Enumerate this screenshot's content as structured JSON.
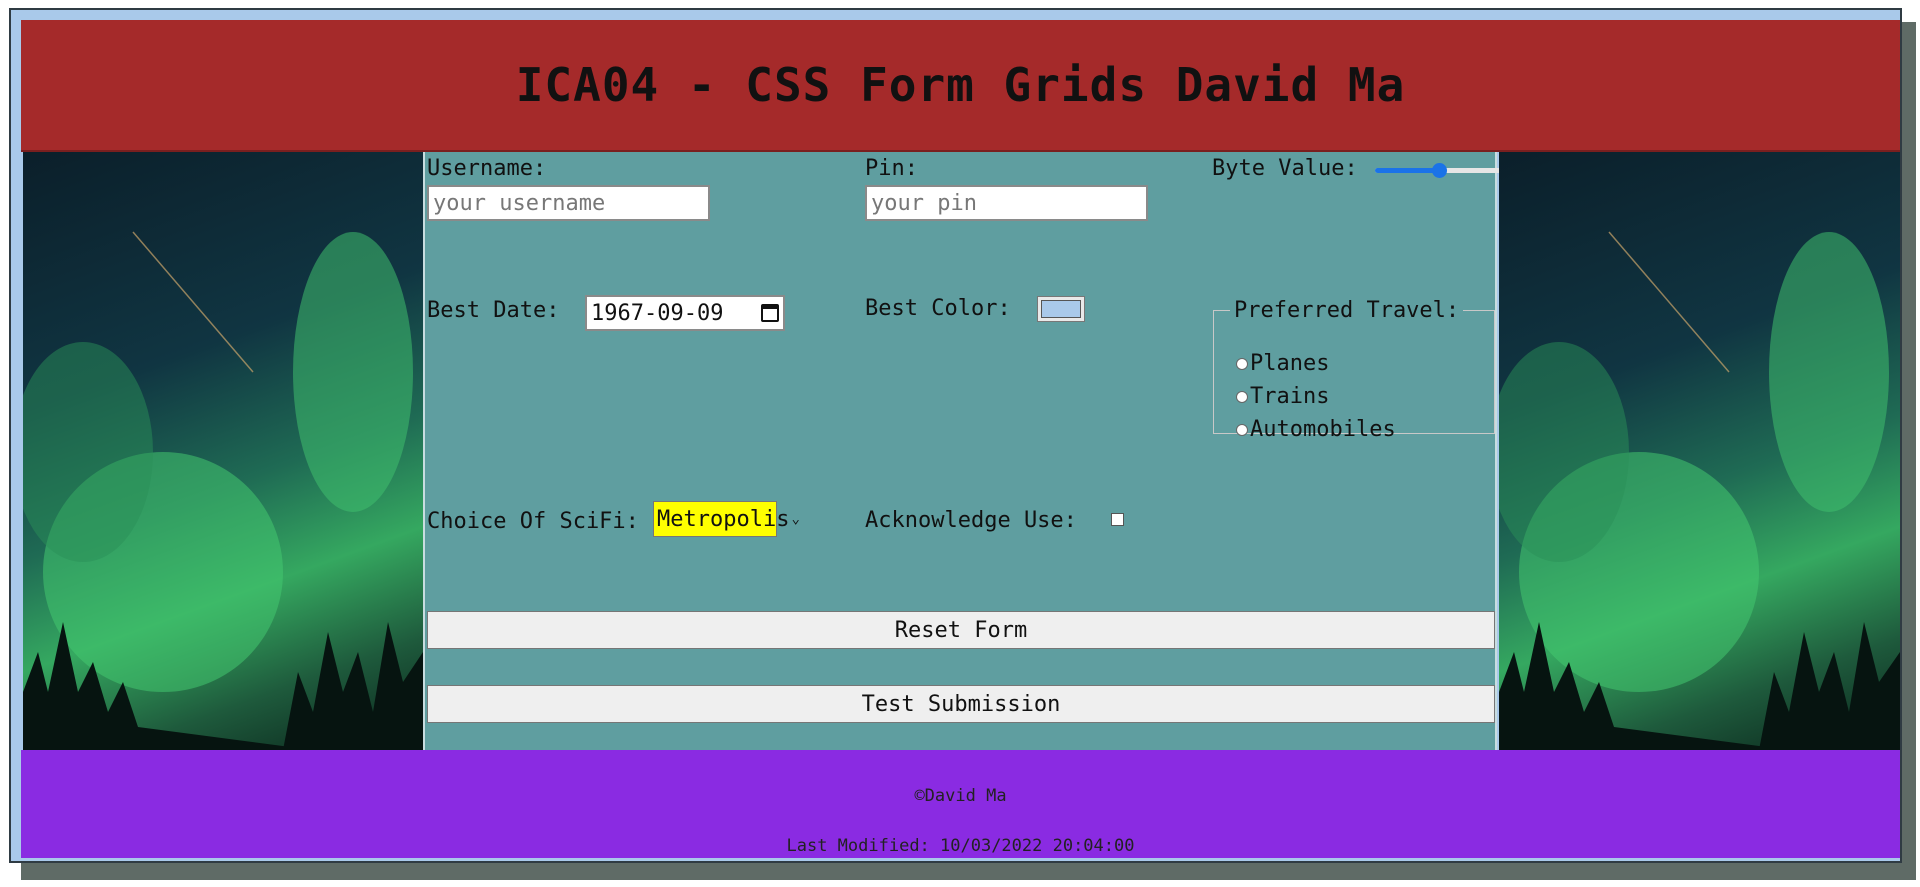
{
  "header": {
    "title": "ICA04 - CSS Form Grids David Ma"
  },
  "form": {
    "username_label": "Username:",
    "username_placeholder": "your username",
    "pin_label": "Pin:",
    "pin_placeholder": "your pin",
    "byte_label": "Byte Value:",
    "byte_value_fraction": 0.5,
    "date_label": "Best Date:",
    "date_value": "1967-09-09",
    "color_label": "Best Color:",
    "color_value": "#a9c9ea",
    "travel_legend": "Preferred Travel:",
    "travel_options": [
      "Planes",
      "Trains",
      "Automobiles"
    ],
    "scifi_label": "Choice Of SciFi:",
    "scifi_value": "Metropolis",
    "ack_label": "Acknowledge Use:",
    "reset_label": "Reset Form",
    "submit_label": "Test Submission"
  },
  "footer": {
    "copyright": "©David Ma",
    "last_modified": "Last Modified: 10/03/2022 20:04:00"
  },
  "colors": {
    "header_bg": "#a52a2a",
    "main_bg": "#5f9ea0",
    "footer_bg": "#8a2be2",
    "page_bg": "#a9c9ea",
    "select_bg": "#ffff00",
    "slider_accent": "#1a73e8"
  },
  "icons": [
    "calendar-icon",
    "chevron-down-icon"
  ]
}
